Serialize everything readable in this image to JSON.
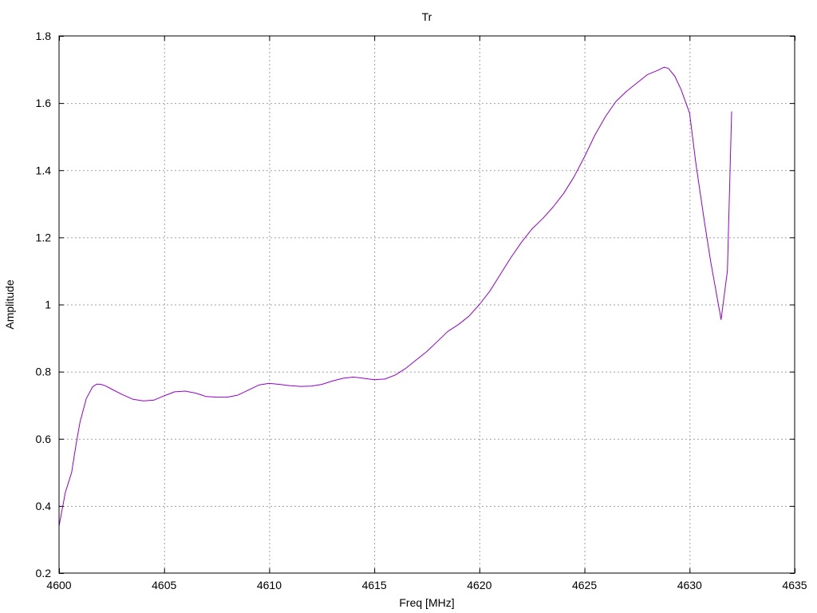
{
  "chart_data": {
    "type": "line",
    "title": "Tr",
    "xlabel": "Freq [MHz]",
    "ylabel": "Amplitude",
    "xlim": [
      4600,
      4635
    ],
    "ylim": [
      0.2,
      1.8
    ],
    "xticks": [
      4600,
      4605,
      4610,
      4615,
      4620,
      4625,
      4630,
      4635
    ],
    "xtick_labels": [
      "4600",
      "4605",
      "4610",
      "4615",
      "4620",
      "4625",
      "4630",
      "4635"
    ],
    "yticks": [
      0.2,
      0.4,
      0.6,
      0.8,
      1.0,
      1.2,
      1.4,
      1.6,
      1.8
    ],
    "ytick_labels": [
      "0.2",
      "0.4",
      "0.6",
      "0.8",
      "1",
      "1.2",
      "1.4",
      "1.6",
      "1.8"
    ],
    "grid": true,
    "line_color": "#9400d3",
    "series": [
      {
        "x": [
          4600.0,
          4600.3,
          4600.6,
          4600.8,
          4601.0,
          4601.3,
          4601.6,
          4601.8,
          4602.0,
          4602.2,
          4602.5,
          4603.0,
          4603.5,
          4604.0,
          4604.5,
          4605.0,
          4605.5,
          4606.0,
          4606.5,
          4607.0,
          4607.5,
          4608.0,
          4608.5,
          4609.0,
          4609.5,
          4610.0,
          4610.5,
          4611.0,
          4611.5,
          4612.0,
          4612.5,
          4613.0,
          4613.5,
          4614.0,
          4614.5,
          4615.0,
          4615.5,
          4616.0,
          4616.5,
          4617.0,
          4617.5,
          4618.0,
          4618.5,
          4619.0,
          4619.5,
          4620.0,
          4620.5,
          4621.0,
          4621.5,
          4622.0,
          4622.5,
          4623.0,
          4623.5,
          4624.0,
          4624.5,
          4625.0,
          4625.5,
          4626.0,
          4626.5,
          4627.0,
          4627.5,
          4628.0,
          4628.5,
          4628.8,
          4629.0,
          4629.3,
          4629.6,
          4630.0,
          4630.3,
          4630.7,
          4631.0,
          4631.5,
          4631.8,
          4632.0
        ],
        "y": [
          0.34,
          0.44,
          0.5,
          0.58,
          0.65,
          0.72,
          0.755,
          0.763,
          0.762,
          0.758,
          0.748,
          0.732,
          0.718,
          0.713,
          0.715,
          0.728,
          0.74,
          0.742,
          0.736,
          0.726,
          0.724,
          0.724,
          0.73,
          0.745,
          0.76,
          0.765,
          0.762,
          0.758,
          0.756,
          0.757,
          0.762,
          0.772,
          0.78,
          0.784,
          0.78,
          0.776,
          0.778,
          0.79,
          0.81,
          0.835,
          0.86,
          0.89,
          0.92,
          0.94,
          0.965,
          1.0,
          1.04,
          1.09,
          1.14,
          1.185,
          1.225,
          1.255,
          1.29,
          1.33,
          1.38,
          1.44,
          1.505,
          1.56,
          1.605,
          1.635,
          1.66,
          1.685,
          1.698,
          1.707,
          1.703,
          1.68,
          1.64,
          1.57,
          1.42,
          1.25,
          1.13,
          0.955,
          1.1,
          1.575
        ]
      }
    ]
  }
}
